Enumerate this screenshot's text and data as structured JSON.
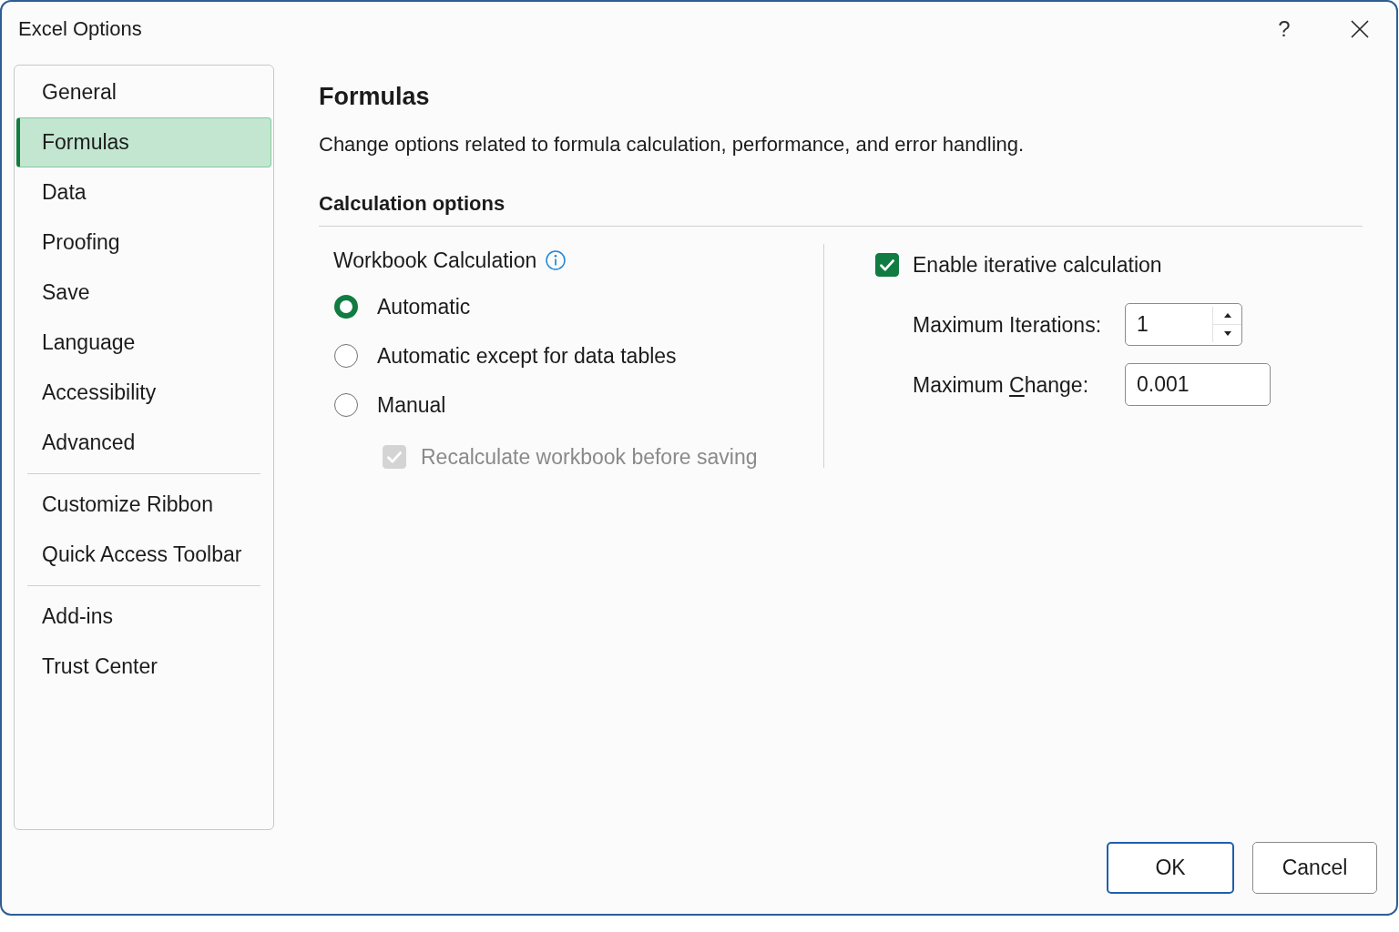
{
  "window": {
    "title": "Excel Options",
    "help_button": "?"
  },
  "sidebar": {
    "groups": [
      {
        "items": [
          {
            "label": "General",
            "selected": false
          },
          {
            "label": "Formulas",
            "selected": true
          },
          {
            "label": "Data",
            "selected": false
          },
          {
            "label": "Proofing",
            "selected": false
          },
          {
            "label": "Save",
            "selected": false
          },
          {
            "label": "Language",
            "selected": false
          },
          {
            "label": "Accessibility",
            "selected": false
          },
          {
            "label": "Advanced",
            "selected": false
          }
        ]
      },
      {
        "items": [
          {
            "label": "Customize Ribbon",
            "selected": false
          },
          {
            "label": "Quick Access Toolbar",
            "selected": false
          }
        ]
      },
      {
        "items": [
          {
            "label": "Add-ins",
            "selected": false
          },
          {
            "label": "Trust Center",
            "selected": false
          }
        ]
      }
    ]
  },
  "page": {
    "title": "Formulas",
    "description": "Change options related to formula calculation, performance, and error handling."
  },
  "calculation_options": {
    "title": "Calculation options",
    "workbook_calculation": {
      "label": "Workbook Calculation",
      "options": [
        {
          "label": "Automatic",
          "selected": true
        },
        {
          "label": "Automatic except for data tables",
          "selected": false
        },
        {
          "label": "Manual",
          "selected": false
        }
      ],
      "recalculate_before_saving": {
        "label": "Recalculate workbook before saving",
        "checked": true,
        "disabled": true
      }
    },
    "iterative_calculation": {
      "label": "Enable iterative calculation",
      "checked": true,
      "disabled": false,
      "fields": [
        {
          "kind": "spinner",
          "label": "Maximum Iterations:",
          "mnemonic_underlined": false,
          "value": "1"
        },
        {
          "kind": "text",
          "label": "Maximum Change:",
          "mnemonic_underlined": true,
          "value": "0.001"
        }
      ]
    }
  },
  "buttons": [
    {
      "label": "OK",
      "default": true
    },
    {
      "label": "Cancel",
      "default": false
    }
  ]
}
